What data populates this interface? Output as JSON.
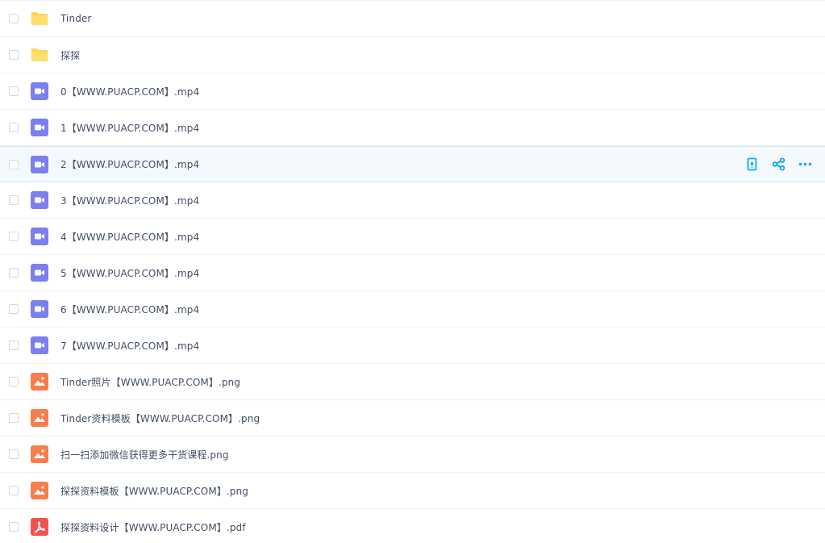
{
  "files": [
    {
      "name": "Tinder",
      "type": "folder"
    },
    {
      "name": "探探",
      "type": "folder"
    },
    {
      "name": "0【WWW.PUACP.COM】.mp4",
      "type": "video"
    },
    {
      "name": "1【WWW.PUACP.COM】.mp4",
      "type": "video"
    },
    {
      "name": "2【WWW.PUACP.COM】.mp4",
      "type": "video",
      "hovered": true
    },
    {
      "name": "3【WWW.PUACP.COM】.mp4",
      "type": "video"
    },
    {
      "name": "4【WWW.PUACP.COM】.mp4",
      "type": "video"
    },
    {
      "name": "5【WWW.PUACP.COM】.mp4",
      "type": "video"
    },
    {
      "name": "6【WWW.PUACP.COM】.mp4",
      "type": "video"
    },
    {
      "name": "7【WWW.PUACP.COM】.mp4",
      "type": "video"
    },
    {
      "name": "Tinder照片【WWW.PUACP.COM】.png",
      "type": "image"
    },
    {
      "name": "Tinder资料模板【WWW.PUACP.COM】.png",
      "type": "image"
    },
    {
      "name": "扫一扫添加微信获得更多干货课程.png",
      "type": "image"
    },
    {
      "name": "探探资料模板【WWW.PUACP.COM】.png",
      "type": "image"
    },
    {
      "name": "探探资料设计【WWW.PUACP.COM】.pdf",
      "type": "pdf"
    }
  ],
  "row_actions": [
    "phone-icon",
    "share-icon",
    "more-icon"
  ],
  "colors": {
    "folder": "#ffd24d",
    "video": "#7b7ff0",
    "image": "#f97d4b",
    "pdf": "#f2524f",
    "action": "#09aaff",
    "text": "#424e67",
    "hover_bg": "#f4f9fe"
  }
}
